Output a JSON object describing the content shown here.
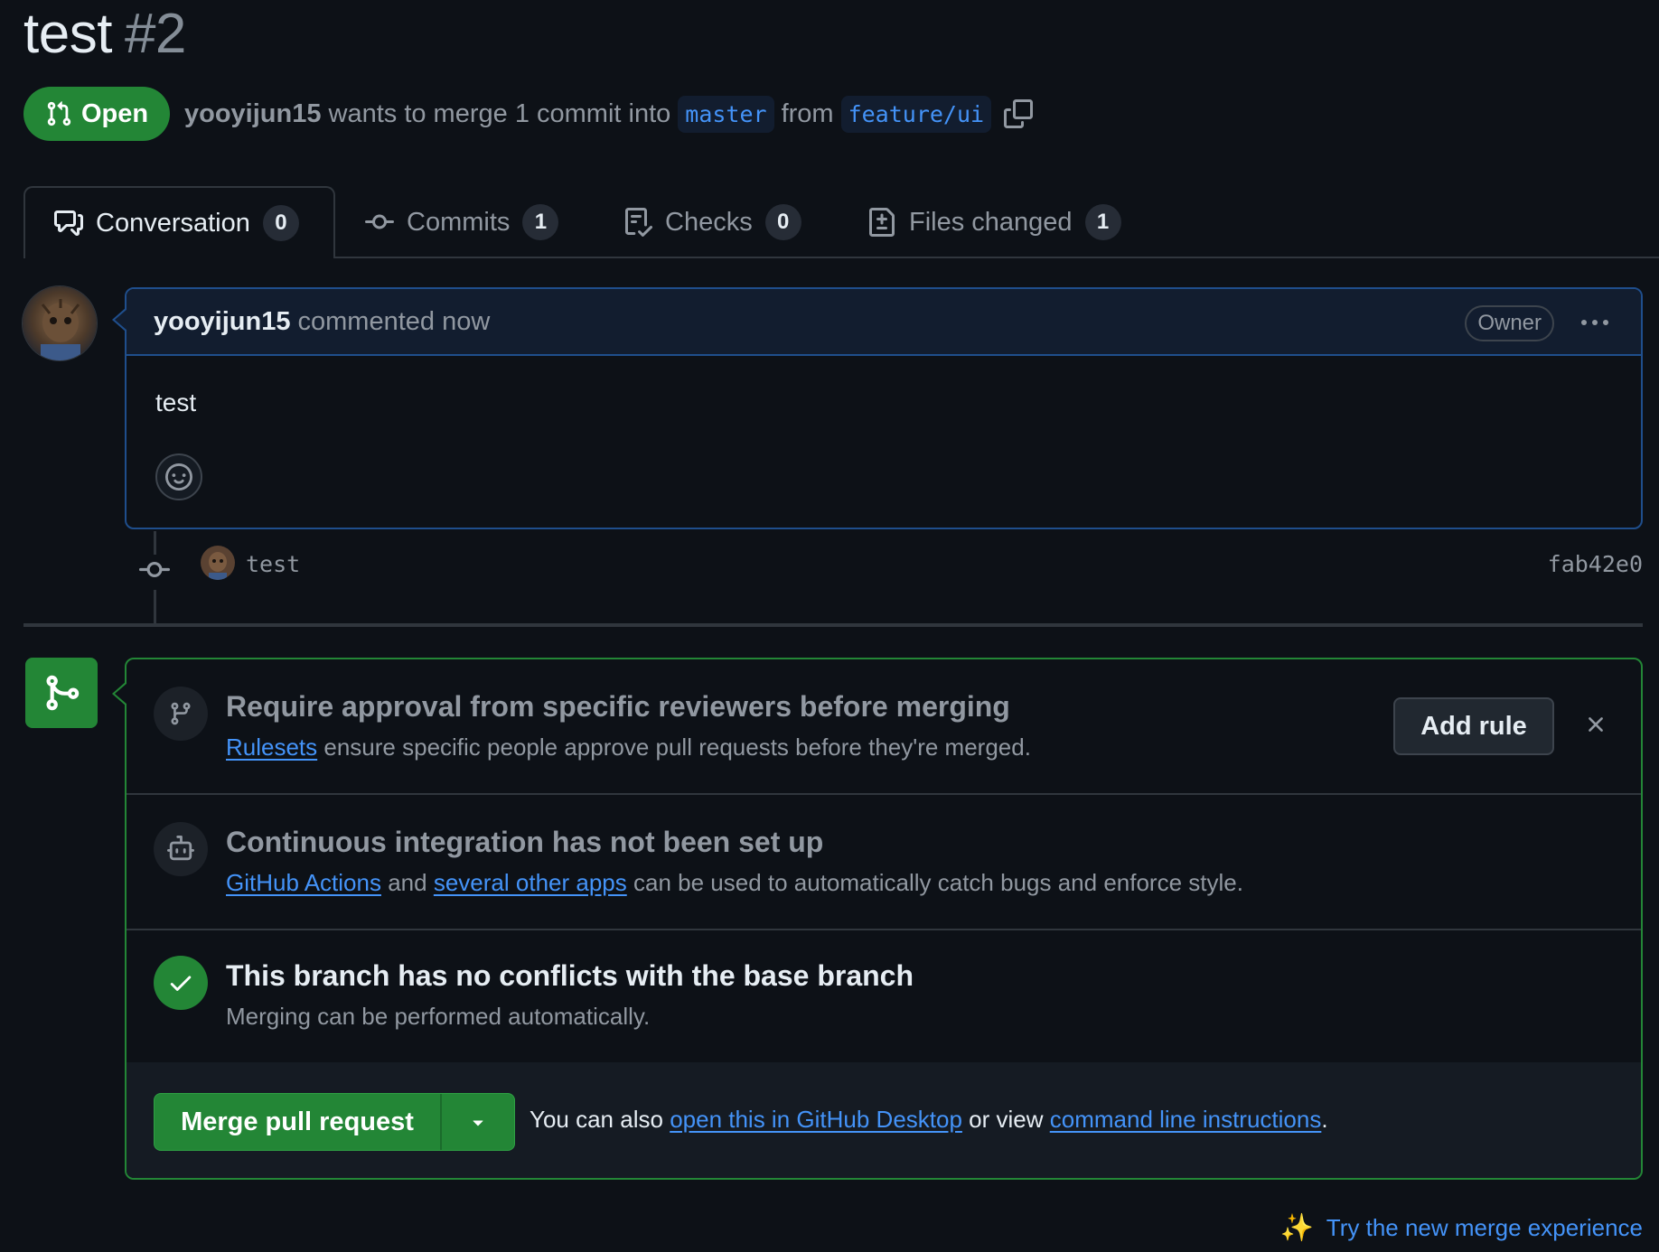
{
  "pr": {
    "title": "test",
    "number": "#2",
    "state": "Open",
    "author": "yooyijun15",
    "merge_text_1": "wants to merge 1 commit into",
    "base_branch": "master",
    "merge_text_2": "from",
    "head_branch": "feature/ui"
  },
  "tabs": [
    {
      "label": "Conversation",
      "count": "0",
      "icon": "comment-discussion-icon"
    },
    {
      "label": "Commits",
      "count": "1",
      "icon": "git-commit-icon"
    },
    {
      "label": "Checks",
      "count": "0",
      "icon": "checklist-icon"
    },
    {
      "label": "Files changed",
      "count": "1",
      "icon": "file-diff-icon"
    }
  ],
  "comment": {
    "author": "yooyijun15",
    "action": "commented now",
    "role": "Owner",
    "body": "test"
  },
  "commit": {
    "message": "test",
    "sha": "fab42e0"
  },
  "merge_box": {
    "approval": {
      "title": "Require approval from specific reviewers before merging",
      "link": "Rulesets",
      "desc": "ensure specific people approve pull requests before they're merged.",
      "button": "Add rule"
    },
    "ci": {
      "title": "Continuous integration has not been set up",
      "link1": "GitHub Actions",
      "mid": "and",
      "link2": "several other apps",
      "desc": "can be used to automatically catch bugs and enforce style."
    },
    "conflicts": {
      "title": "This branch has no conflicts with the base branch",
      "desc": "Merging can be performed automatically."
    },
    "action": {
      "merge_button": "Merge pull request",
      "text1": "You can also",
      "link1": "open this in GitHub Desktop",
      "text2": "or view",
      "link2": "command line instructions",
      "text3": "."
    }
  },
  "footer": {
    "try_new": "Try the new merge experience",
    "sparkle": "✨"
  },
  "colors": {
    "background": "#0d1117",
    "accent_green": "#238636",
    "link_blue": "#4493f8",
    "comment_border": "#1f4e8c"
  }
}
